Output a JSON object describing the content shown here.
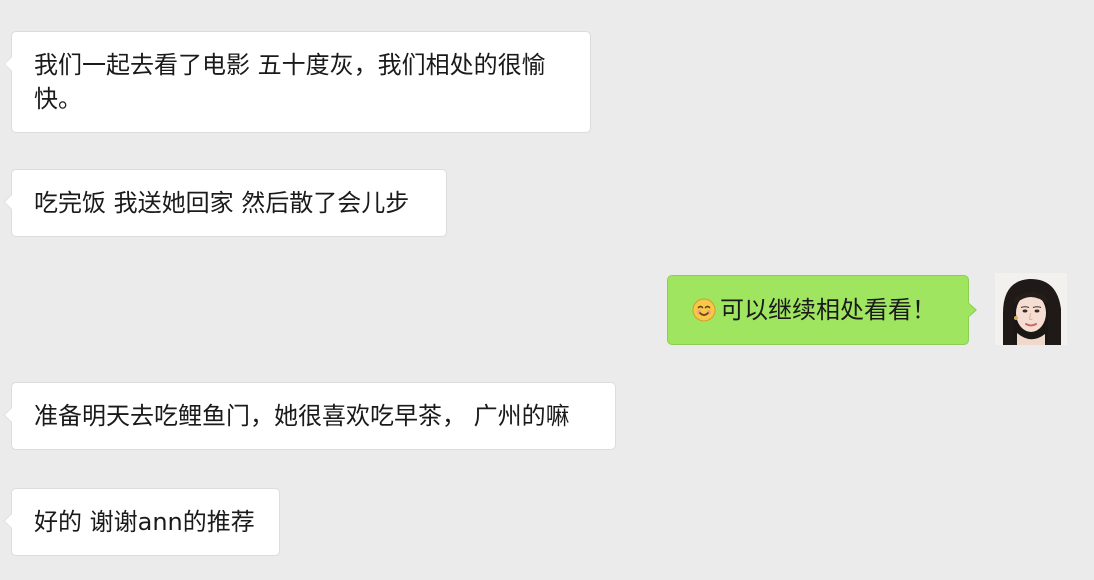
{
  "conversation": {
    "messages": [
      {
        "direction": "incoming",
        "text": "我们一起去看了电影 五十度灰，我们相处的很愉快。"
      },
      {
        "direction": "incoming",
        "text": "吃完饭 我送她回家 然后散了会儿步"
      },
      {
        "direction": "outgoing",
        "emoji": "smiling-face-emoji",
        "text": "可以继续相处看看！"
      },
      {
        "direction": "incoming",
        "text": "准备明天去吃鲤鱼门，她很喜欢吃早茶， 广州的嘛"
      },
      {
        "direction": "incoming",
        "text": "好的 谢谢ann的推荐"
      }
    ]
  },
  "colors": {
    "background": "#ebebeb",
    "incoming_bubble": "#ffffff",
    "outgoing_bubble": "#9fe55f",
    "text": "#1a1a1a"
  },
  "icons": {
    "avatar": "user-avatar-photo"
  }
}
